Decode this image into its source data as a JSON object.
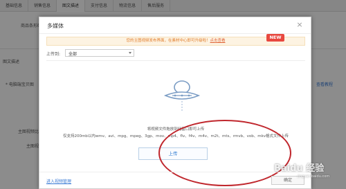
{
  "background": {
    "tabs": [
      {
        "label": "基础信息"
      },
      {
        "label": "销售信息"
      },
      {
        "label": "图文描述"
      },
      {
        "label": "支付信息"
      },
      {
        "label": "物流信息"
      },
      {
        "label": "售后服务"
      }
    ],
    "active_tab": 2,
    "labels": {
      "product_size": "商品条形码",
      "desc_section": "图文描述",
      "desc_field": "* 电脑端宝贝图",
      "main_video": "主图视频比例",
      "main_video2": "主图视",
      "more_link": "查看教程"
    }
  },
  "modal": {
    "title": "多媒体",
    "close": "×",
    "notice_text": "您的主图视频发布界面，在素材中心即可升级啦！",
    "notice_link": "点击查看",
    "new_badge": "NEW",
    "upload_to_label": "上传到:",
    "upload_to_value": "全部",
    "drag_hint": "将视频文件拖放到此窗口即可上传",
    "support_text": "仅支持200mb以内wmv、avi、mpg、mpeg、3gp、mov、mp4、flv、f4v、m4v、m2t、mts、rmvb、vob、mkv格式文件上传",
    "upload_button": "上传",
    "footer_link": "进入视频管理",
    "confirm_button": "确定"
  },
  "watermark": {
    "text": "Baidu 经验",
    "sub": "jingyan.baidu.com"
  },
  "colors": {
    "accent": "#2f7bd0",
    "notice_bg": "#fdf3e2",
    "notice_text": "#e07b28",
    "badge": "#e8483f",
    "annotation": "#c0272d"
  },
  "icons": {
    "upload": "cloud-upload-icon",
    "close": "close-icon",
    "dropdown": "chevron-down-icon"
  }
}
